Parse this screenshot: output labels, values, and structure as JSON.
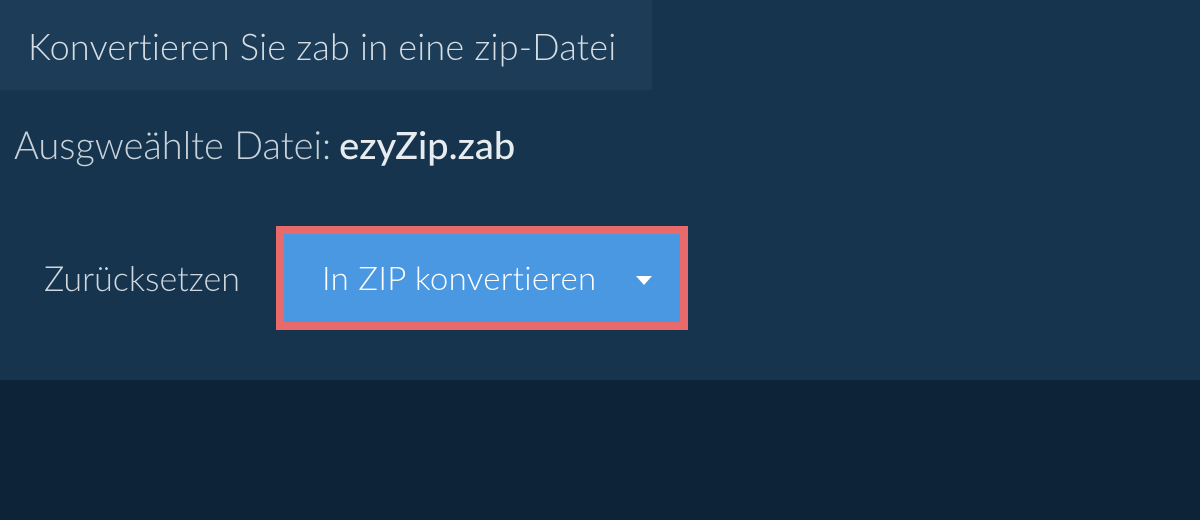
{
  "tab": {
    "title": "Konvertieren Sie zab in eine zip-Datei"
  },
  "selectedFile": {
    "label": "Ausgweählte Datei:",
    "name": "ezyZip.zab"
  },
  "actions": {
    "resetLabel": "Zurücksetzen",
    "convertLabel": "In ZIP konvertieren"
  }
}
